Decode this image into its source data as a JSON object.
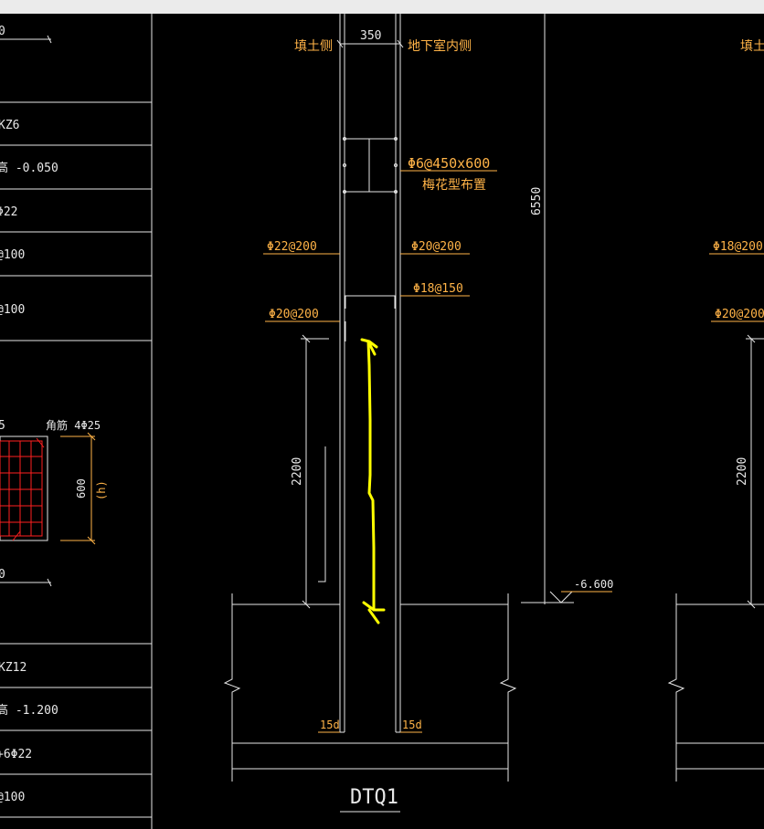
{
  "left_table": {
    "rows": [
      {
        "text": "0"
      },
      {
        "text": "KZ6"
      },
      {
        "text": "高 -0.050"
      },
      {
        "text": "Φ22"
      },
      {
        "text": "@100"
      },
      {
        "text": "@100"
      },
      {
        "text": "0"
      },
      {
        "text": "KZ12"
      },
      {
        "text": "高 -1.200"
      },
      {
        "text": "+6Φ22"
      },
      {
        "text": "@100"
      }
    ],
    "section": {
      "top_label": "5",
      "corner_label": "角筋 4Φ25",
      "dim_h": "600",
      "dim_h_tag": "(h)"
    }
  },
  "wall_detail": {
    "fill_side": "填土侧",
    "inner_side": "地下室内侧",
    "wall_thickness": "350",
    "tie_rebar": "Φ6@450x600",
    "tie_layout": "梅花型布置",
    "outer_vertical": "Φ22@200",
    "inner_vertical": "Φ20@200",
    "horizontal": "Φ18@150",
    "outer_added": "Φ20@200",
    "height": "6550",
    "lap_length": "2200",
    "elevation": "-6.600",
    "anchor_left": "15d",
    "anchor_right": "15d",
    "title": "DTQ1"
  },
  "right_detail": {
    "fill_side": "填土侧",
    "vertical": "Φ18@200",
    "added": "Φ20@200",
    "lap_length": "2200"
  },
  "colors": {
    "line": "#e6e6e6",
    "annotation": "#ffb347",
    "rebar_section": "#ff2020",
    "markup": "#ffff00",
    "background": "#000000"
  }
}
